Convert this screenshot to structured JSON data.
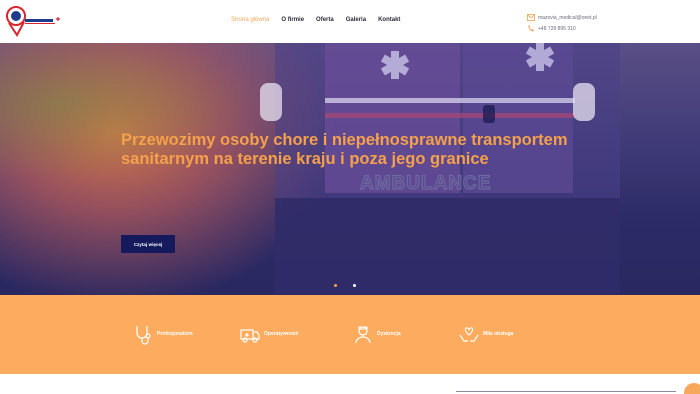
{
  "nav": {
    "items": [
      "Strona główna",
      "O firmie",
      "Oferta",
      "Galeria",
      "Kontakt"
    ],
    "active": "Strona główna"
  },
  "contact": {
    "email": "mazovia_medical@onet.pl",
    "phone": "+48 728 895 310"
  },
  "hero": {
    "title": "Przewozimy osoby chore i niepełnosprawne transportem sanitarnym na terenie kraju i poza jego granice",
    "button": "Czytaj więcej",
    "van_text": "AMBULANCE",
    "slides": 2,
    "active_slide": 1
  },
  "features": [
    {
      "label": "Profesjonalizm",
      "icon": "stethoscope-icon"
    },
    {
      "label": "Operatywność",
      "icon": "ambulance-icon"
    },
    {
      "label": "Dyskrecja",
      "icon": "nurse-icon"
    },
    {
      "label": "Miła obsługa",
      "icon": "care-hands-icon"
    }
  ],
  "colors": {
    "accent": "#f5a04a",
    "navy": "#151a5c",
    "feature_bg": "#fdac5f"
  }
}
